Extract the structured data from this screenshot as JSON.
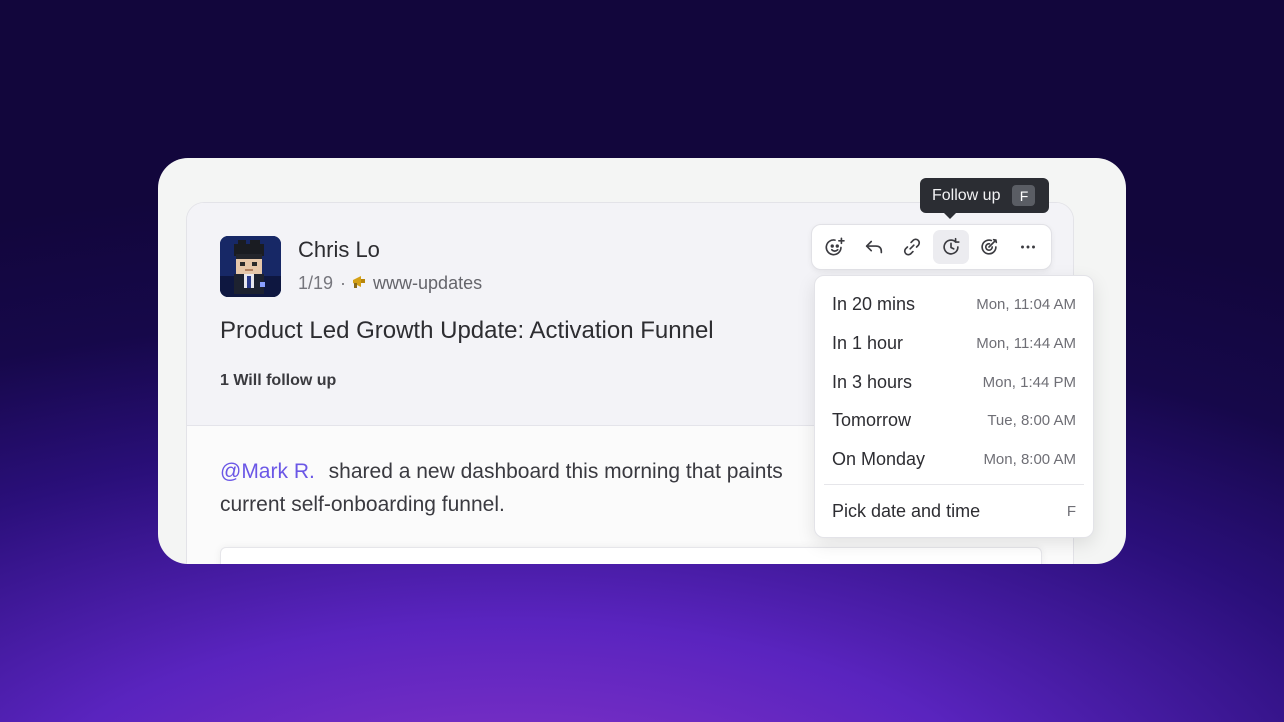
{
  "message": {
    "author": "Chris Lo",
    "date": "1/19",
    "separator": "·",
    "channel_icon": "megaphone-icon",
    "channel": "www-updates",
    "subject": "Product Led Growth Update: Activation Funnel",
    "followers": "1 Will follow up",
    "mention": "@Mark R.",
    "body": "shared a new dashboard this morning that paints",
    "body_line2": "current self-onboarding funnel."
  },
  "toolbar": {
    "buttons": [
      "add-reaction-icon",
      "reply-icon",
      "link-icon",
      "follow-up-clock-icon",
      "target-icon",
      "more-icon"
    ]
  },
  "tooltip": {
    "label": "Follow up",
    "shortcut": "F"
  },
  "follow_up_menu": {
    "items": [
      {
        "label": "In 20 mins",
        "time": "Mon, 11:04 AM"
      },
      {
        "label": "In 1 hour",
        "time": "Mon, 11:44 AM"
      },
      {
        "label": "In 3 hours",
        "time": "Mon, 1:44 PM"
      },
      {
        "label": "Tomorrow",
        "time": "Tue, 8:00 AM"
      },
      {
        "label": "On Monday",
        "time": "Mon, 8:00 AM"
      }
    ],
    "custom": {
      "label": "Pick date and time",
      "shortcut": "F"
    }
  },
  "colors": {
    "mention": "#6b57e6",
    "tooltip_bg": "#2b2d33",
    "accent_bg_top": "#12063c",
    "accent_bg_bottom": "#8b35c8"
  }
}
